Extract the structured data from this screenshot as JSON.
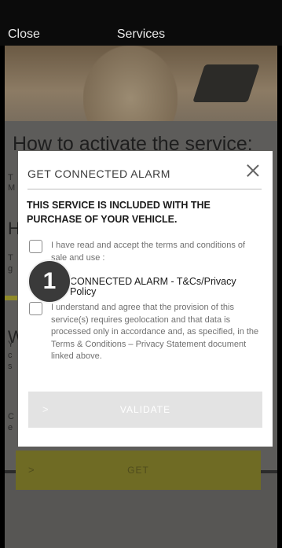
{
  "topbar": {
    "close_label": "Close",
    "title": "Services"
  },
  "background": {
    "heading": "How to activate the service:",
    "letters": [
      "T",
      "M",
      "H",
      "T",
      "g",
      "W",
      "Y",
      "c",
      "s",
      "C",
      "e"
    ],
    "get_label": "GET",
    "get_chevron": ">"
  },
  "modal": {
    "header": "GET CONNECTED ALARM",
    "notice": "THIS SERVICE IS INCLUDED WITH THE PURCHASE OF YOUR VEHICLE.",
    "terms_text": "I have read and accept the terms and conditions of sale and use :",
    "doc_link": "CONNECTED ALARM - T&Cs/Privacy Policy",
    "consent_text": "I understand and agree that the provision of this service(s) requires geolocation and that data is processed only in accordance and, as specified, in the Terms & Conditions – Privacy Statement document linked above.",
    "validate_label": "VALIDATE",
    "validate_chevron": ">"
  },
  "step_badge": "1",
  "colors": {
    "accent_yellow": "#6f6b24",
    "overlay": "#5d5c5a",
    "modal_bg": "#ffffff",
    "badge_bg": "#3a3a3a"
  }
}
